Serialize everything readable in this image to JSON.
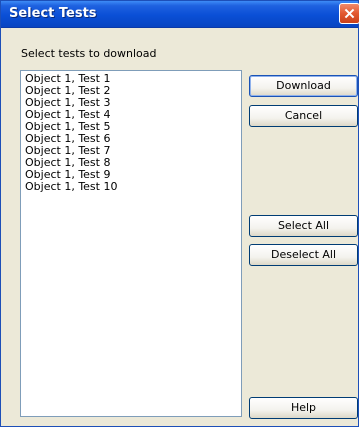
{
  "window": {
    "title": "Select Tests"
  },
  "prompt": "Select tests to download",
  "tests": [
    "Object 1, Test 1",
    "Object 1, Test 2",
    "Object 1, Test 3",
    "Object 1, Test 4",
    "Object 1, Test 5",
    "Object 1, Test 6",
    "Object 1, Test 7",
    "Object 1, Test 8",
    "Object 1, Test 9",
    "Object 1, Test 10"
  ],
  "buttons": {
    "download": "Download",
    "cancel": "Cancel",
    "select_all": "Select All",
    "deselect_all": "Deselect All",
    "help": "Help"
  },
  "colors": {
    "title_bar": "#0a4fd6",
    "close_button": "#e2582f",
    "dialog_background": "#ece9d8"
  },
  "icons": {
    "close": "close-icon"
  }
}
